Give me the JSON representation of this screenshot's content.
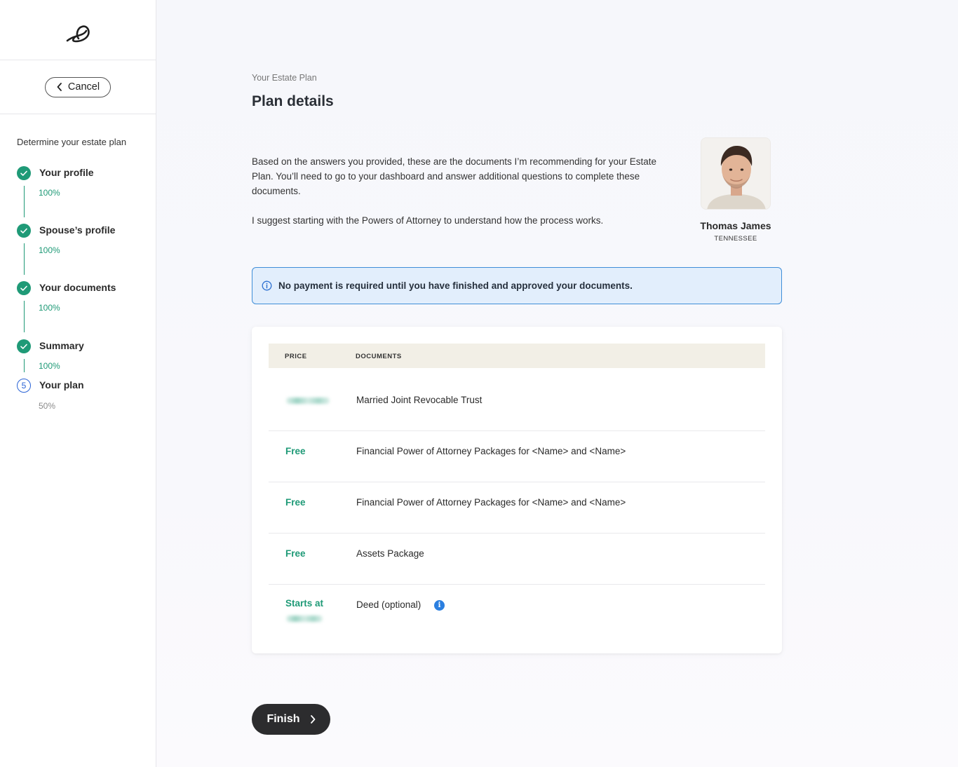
{
  "sidebar": {
    "cancel_label": "Cancel",
    "steps_title": "Determine your estate plan",
    "steps": [
      {
        "label": "Your profile",
        "progress": "100%",
        "status": "done"
      },
      {
        "label": "Spouse’s profile",
        "progress": "100%",
        "status": "done"
      },
      {
        "label": "Your documents",
        "progress": "100%",
        "status": "done"
      },
      {
        "label": "Summary",
        "progress": "100%",
        "status": "done"
      },
      {
        "label": "Your plan",
        "progress": "50%",
        "status": "active",
        "number": "5"
      }
    ]
  },
  "main": {
    "eyebrow": "Your Estate Plan",
    "title": "Plan details",
    "intro_p1": "Based on the answers you provided, these are the documents I’m recommending for your Estate Plan. You’ll need to go to your dashboard and answer additional questions to complete these documents.",
    "intro_p2": "I suggest starting with the Powers of Attorney  to understand how the process works.",
    "agent": {
      "name": "Thomas James",
      "state": "TENNESSEE"
    },
    "notice": "No payment is required until you have finished and approved your documents.",
    "table": {
      "headers": {
        "price": "PRICE",
        "documents": "DOCUMENTS"
      },
      "rows": [
        {
          "price": "",
          "price_hidden": true,
          "document": "Married Joint Revocable Trust"
        },
        {
          "price": "Free",
          "document": "Financial Power of Attorney Packages for <Name> and <Name>"
        },
        {
          "price": "Free",
          "document": "Financial Power of Attorney Packages for <Name> and <Name>"
        },
        {
          "price": "Free",
          "document": "Assets Package"
        },
        {
          "price": "Starts at",
          "price_hidden": true,
          "document": "Deed (optional)",
          "info_icon": "i"
        }
      ]
    },
    "finish_label": "Finish"
  },
  "colors": {
    "accent_green": "#1f9a77",
    "info_blue": "#2b7fe0",
    "button_dark": "#2c2c2e",
    "notice_bg": "#e2eefc"
  }
}
